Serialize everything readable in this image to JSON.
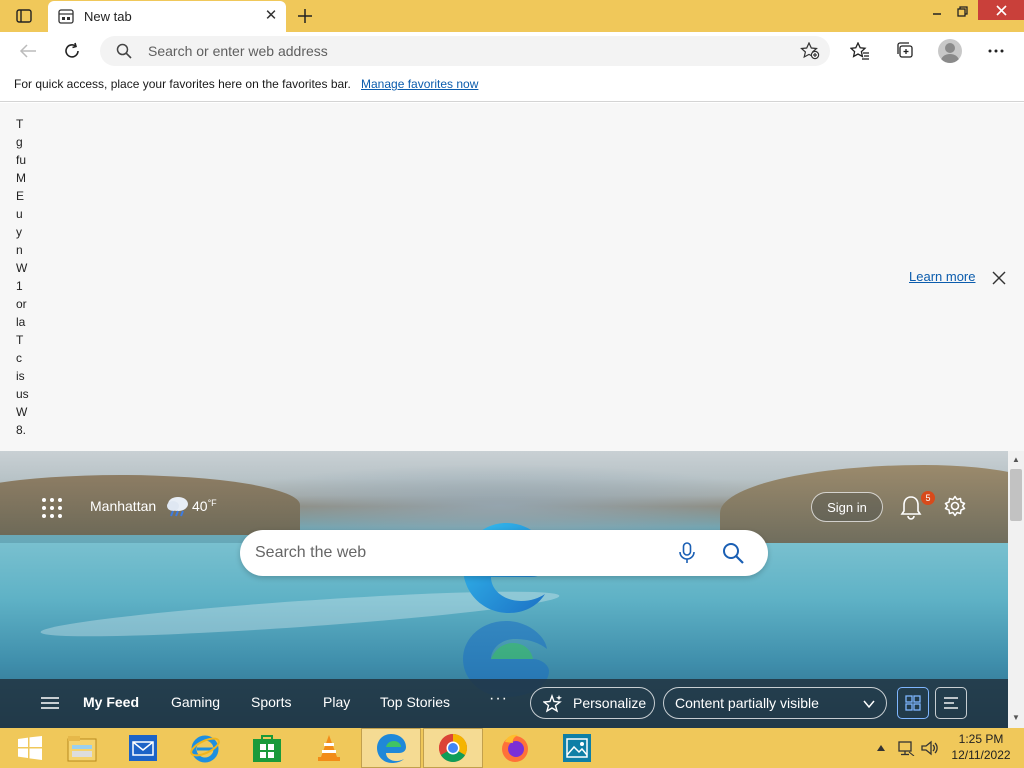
{
  "browser": {
    "tab": {
      "title": "New tab"
    },
    "address": {
      "placeholder": "Search or enter web address"
    },
    "favorites_bar": {
      "message": "For quick access, place your favorites here on the favorites bar.",
      "link": "Manage favorites now"
    }
  },
  "notice": {
    "vertical_letters": [
      "T",
      "g",
      "fu",
      "M",
      "E",
      "u",
      "y",
      "n",
      "W",
      "1",
      "or",
      "la",
      "T",
      "c",
      "is",
      "us",
      "W",
      "8."
    ],
    "learn_more": "Learn more"
  },
  "ntp": {
    "weather": {
      "location": "Manhattan",
      "temp": "40",
      "unit": "°F"
    },
    "sign_in": "Sign in",
    "notifications_count": "5",
    "search": {
      "placeholder": "Search the web"
    },
    "feed_tabs": [
      "My Feed",
      "Gaming",
      "Sports",
      "Play",
      "Top Stories"
    ],
    "more": "···",
    "personalize": "Personalize",
    "content_visibility": "Content partially visible"
  },
  "taskbar": {
    "apps": [
      "start-icon",
      "file-explorer-icon",
      "mail-icon",
      "internet-explorer-icon",
      "store-icon",
      "vlc-icon",
      "edge-icon",
      "chrome-icon",
      "firefox-icon",
      "photos-icon"
    ],
    "clock": {
      "time": "1:25 PM",
      "date": "12/11/2022"
    }
  },
  "colors": {
    "titlebar": "#f0c85a",
    "link": "#0b5cad",
    "close": "#c9403a"
  }
}
